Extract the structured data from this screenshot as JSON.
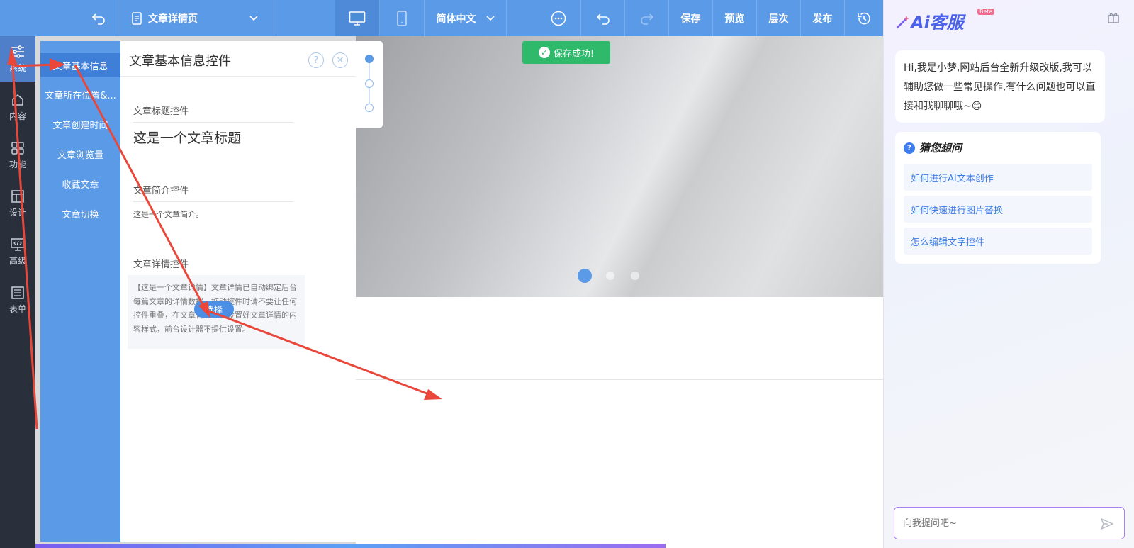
{
  "toolbar": {
    "page_name": "文章详情页",
    "language": "简体中文",
    "save": "保存",
    "preview": "预览",
    "layers": "层次",
    "publish": "发布"
  },
  "rail": {
    "items": [
      {
        "label": "系统",
        "icon": "sliders-icon"
      },
      {
        "label": "内容",
        "icon": "home-icon"
      },
      {
        "label": "功能",
        "icon": "grid-icon"
      },
      {
        "label": "设计",
        "icon": "layout-icon"
      },
      {
        "label": "高级",
        "icon": "code-monitor-icon"
      },
      {
        "label": "表单",
        "icon": "form-icon"
      }
    ]
  },
  "submenu": {
    "items": [
      "文章基本信息",
      "文章所在位置&...",
      "文章创建时间",
      "文章浏览量",
      "收藏文章",
      "文章切换"
    ]
  },
  "panel": {
    "title": "文章基本信息控件",
    "help_icon": "?",
    "close_icon": "✕",
    "title_control_label": "文章标题控件",
    "article_title": "这是一个文章标题",
    "summary_control_label": "文章简介控件",
    "article_summary": "这是一个文章简介。",
    "detail_control_label": "文章详情控件",
    "detail_text": "【这是一个文章详情】文章详情已自动绑定后台每篇文章的详情数据。拖动控件时请不要让任何控件重叠，在文章管理直接设置好文章详情的内容样式，前台设计器不提供设置。",
    "select_button": "选择"
  },
  "toast": {
    "text": "保存成功!"
  },
  "carousel": {
    "dots": 3,
    "active_index": 0
  },
  "ai": {
    "logo": "Ai客服",
    "beta": "Beta",
    "greeting": "Hi,我是小梦,网站后台全新升级改版,我可以辅助您做一些常见操作,有什么问题也可以直接和我聊聊哦~😊",
    "guess_title": "猜您想问",
    "questions": [
      "如何进行AI文本创作",
      "如何快速进行图片替换",
      "怎么编辑文字控件"
    ],
    "input_placeholder": "向我提问吧~"
  },
  "colors": {
    "toolbar_blue": "#5b9ae6",
    "rail_dark": "#2a2f3c",
    "toast_green": "#2fb96a",
    "arrow_red": "#e8473a"
  }
}
